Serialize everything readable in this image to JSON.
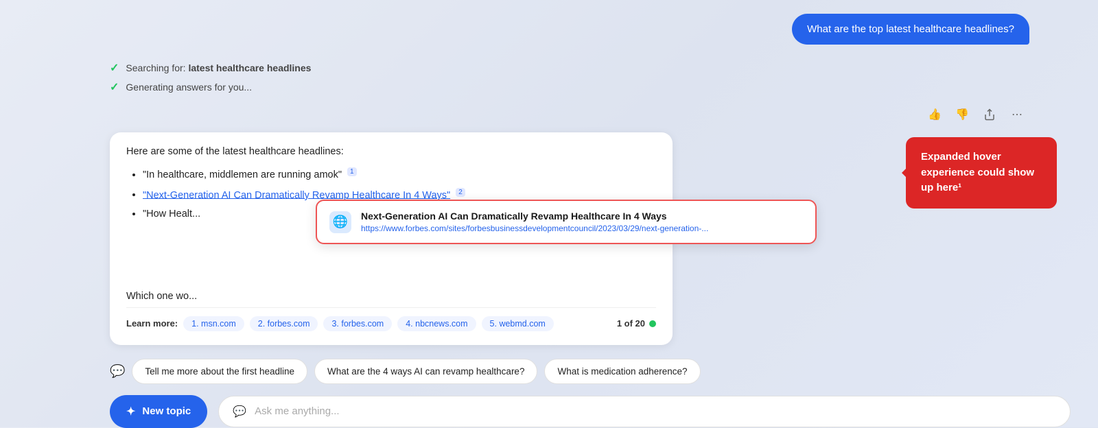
{
  "user_message": {
    "text": "What are the top latest healthcare headlines?"
  },
  "status": {
    "line1_prefix": "Searching for: ",
    "line1_bold": "latest healthcare headlines",
    "line2": "Generating answers for you..."
  },
  "toolbar": {
    "thumbs_up": "👍",
    "thumbs_down": "👎",
    "share": "↗",
    "more": "⋯"
  },
  "answer": {
    "intro": "Here are some of the latest healthcare headlines:",
    "bullets": [
      {
        "text": "“In healthcare, middlemen are running amok”",
        "superscript": "1",
        "is_link": false
      },
      {
        "text": "“Next-Generation AI Can Dramatically Revamp Healthcare In 4 Ways”",
        "superscript": "2",
        "is_link": true
      },
      {
        "text": "“How Healt...",
        "superscript": "",
        "is_link": false
      }
    ],
    "which_text": "Which one wo..."
  },
  "hover_tooltip": {
    "title": "Next-Generation AI Can Dramatically Revamp Healthcare In 4 Ways",
    "url": "https://www.forbes.com/sites/forbesbusinessdevelopmentcouncil/2023/03/29/next-generation-..."
  },
  "expanded_hover": {
    "text": "Expanded hover experience could show up here¹"
  },
  "learn_more": {
    "label": "Learn more:",
    "sources": [
      "1. msn.com",
      "2. forbes.com",
      "3. forbes.com",
      "4. nbcnews.com",
      "5. webmd.com"
    ],
    "page": "1 of 20"
  },
  "suggestions": [
    "Tell me more about the first headline",
    "What are the 4 ways AI can revamp healthcare?",
    "What is medication adherence?"
  ],
  "input": {
    "new_topic_label": "New topic",
    "placeholder": "Ask me anything..."
  }
}
